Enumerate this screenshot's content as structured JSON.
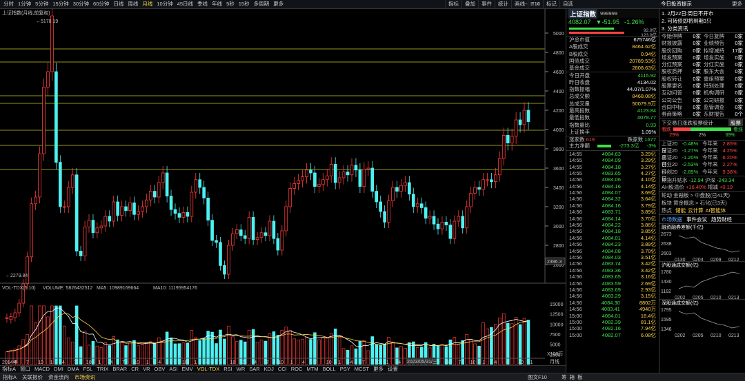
{
  "toolbar": {
    "periods": [
      "分时",
      "1分钟",
      "5分钟",
      "15分钟",
      "30分钟",
      "60分钟",
      "日线",
      "周线",
      "月线",
      "10分钟",
      "45日线",
      "季线",
      "年线",
      "5秒",
      "15秒",
      "多周期",
      "更多"
    ],
    "active_period": "月线",
    "tools": [
      "指标",
      "叠加",
      "事件",
      "统计",
      "画线",
      "F10",
      "标记",
      "自选"
    ],
    "window_controls": [
      "–",
      "□",
      "×"
    ],
    "right_title": "今日投资提示",
    "right_more": "更多"
  },
  "chart": {
    "title": "上证指数(月线,前复权)",
    "high_label": "5178.19",
    "low_label": "2279.84",
    "last_box": "2396.3",
    "y_ticks": [
      "5000",
      "4800",
      "4600",
      "4400",
      "4200",
      "4000",
      "3800",
      "3600",
      "3400",
      "3200",
      "3000",
      "2800",
      "2600"
    ],
    "x_ticks": [
      "2014年",
      "4",
      "7",
      "10",
      "1",
      "4",
      "7",
      "10",
      "1",
      "4",
      "7",
      "10",
      "1",
      "4",
      "7",
      "10",
      "1",
      "4",
      "7",
      "10",
      "1",
      "4",
      "7",
      "10",
      "1",
      "4",
      "7",
      "10",
      "1",
      "4",
      "7",
      "10",
      "1",
      "4",
      "7",
      "10",
      "1",
      "4",
      "7",
      "10",
      "1",
      "4",
      "7",
      "10",
      "1"
    ],
    "cursor_date": "2023/05/31/三",
    "corner_label": "月线",
    "zoom_label": "X100万",
    "colors": {
      "up": "#ff3b3b",
      "down": "#4ef0f0",
      "ma_line": "#ffd24a"
    }
  },
  "volume": {
    "header": "VOL-TDX(5,10)",
    "volume_label": "VOLUME: 5826432512",
    "ma5_label": "MA5: 10989169664",
    "ma10_label": "MA10: 11195954176",
    "y_ticks": [
      "15000",
      "12500",
      "10000",
      "7500",
      "5000",
      "2500"
    ]
  },
  "indicators": [
    "指标A",
    "窗口",
    "MACD",
    "DMI",
    "DMA",
    "FSL",
    "TRIX",
    "BRAR",
    "CR",
    "VR",
    "OBV",
    "ASI",
    "EMV",
    "VOL-TDX",
    "RSI",
    "WR",
    "SAR",
    "KDJ",
    "CCI",
    "ROC",
    "MTM",
    "BOLL",
    "PSY",
    "MCST",
    "更多",
    "设置"
  ],
  "active_indicator": "VOL-TDX",
  "quote": {
    "index_name": "上证指数",
    "code": "999999",
    "price": "4082.07",
    "change": "▼-51.95",
    "change_pct": "-1.26%",
    "bar1_label": "92.0亿",
    "bar2_label": "123.0亿",
    "rows": [
      {
        "k": "沪总市值",
        "v": "675746亿",
        "c": "white"
      },
      {
        "k": "A股成交",
        "v": "8464.62亿",
        "c": "yellow"
      },
      {
        "k": "B股成交",
        "v": "0.94亿",
        "c": "yellow"
      },
      {
        "k": "国债成交",
        "v": "20789.53亿",
        "c": "yellow"
      },
      {
        "k": "基金成交",
        "v": "2808.63亿",
        "c": "yellow"
      },
      {
        "k": "今日开盘",
        "v": "4115.92",
        "c": "green"
      },
      {
        "k": "昨日收盘",
        "v": "4134.02",
        "c": "white"
      },
      {
        "k": "指数振幅",
        "v": "44.07/1.07%",
        "c": "white"
      },
      {
        "k": "总成交额",
        "v": "8468.08亿",
        "c": "yellow"
      },
      {
        "k": "总成交量",
        "v": "50079.9万",
        "c": "yellow"
      },
      {
        "k": "最高指数",
        "v": "4123.84",
        "c": "green"
      },
      {
        "k": "最低指数",
        "v": "4079.77",
        "c": "green"
      },
      {
        "k": "指数量比",
        "v": "0.93",
        "c": "green"
      },
      {
        "k": "上证换手",
        "v": "1.05%",
        "c": "white"
      }
    ],
    "up_label": "涨家数",
    "up_count": "619",
    "down_label": "跌家数",
    "down_count": "1677",
    "main_flow_label": "主力净额",
    "main_flow_value": "-273.3亿",
    "main_flow_pct": "-3%",
    "ticks": [
      {
        "t": "14:55",
        "p": "4084.63",
        "v": "3.29亿"
      },
      {
        "t": "14:55",
        "p": "4084.09",
        "v": "3.29亿"
      },
      {
        "t": "14:55",
        "p": "4084.18",
        "v": "3.27亿"
      },
      {
        "t": "14:55",
        "p": "4083.65",
        "v": "4.27亿"
      },
      {
        "t": "14:56",
        "p": "4084.06",
        "v": "4.10亿"
      },
      {
        "t": "14:56",
        "p": "4084.16",
        "v": "4.14亿"
      },
      {
        "t": "14:56",
        "p": "4084.07",
        "v": "3.69亿"
      },
      {
        "t": "14:56",
        "p": "4084.32",
        "v": "3.64亿"
      },
      {
        "t": "14:56",
        "p": "4084.16",
        "v": "3.79亿"
      },
      {
        "t": "14:56",
        "p": "4083.71",
        "v": "3.89亿"
      },
      {
        "t": "14:56",
        "p": "4084.14",
        "v": "3.70亿"
      },
      {
        "t": "14:56",
        "p": "4084.22",
        "v": "3.86亿"
      },
      {
        "t": "14:56",
        "p": "4084.18",
        "v": "3.85亿"
      },
      {
        "t": "14:56",
        "p": "4084.01",
        "v": "4.14亿"
      },
      {
        "t": "14:56",
        "p": "4084.23",
        "v": "3.89亿"
      },
      {
        "t": "14:56",
        "p": "4084.08",
        "v": "3.70亿"
      },
      {
        "t": "14:56",
        "p": "4084.03",
        "v": "3.51亿"
      },
      {
        "t": "14:56",
        "p": "4083.74",
        "v": "3.42亿"
      },
      {
        "t": "14:56",
        "p": "4083.36",
        "v": "3.42亿"
      },
      {
        "t": "14:56",
        "p": "4083.65",
        "v": "3.16亿"
      },
      {
        "t": "14:56",
        "p": "4083.59",
        "v": "2.69亿"
      },
      {
        "t": "14:56",
        "p": "4083.69",
        "v": "2.93亿"
      },
      {
        "t": "14:56",
        "p": "4083.29",
        "v": "3.15亿"
      },
      {
        "t": "14:56",
        "p": "4084.30",
        "v": "8802万"
      },
      {
        "t": "14:56",
        "p": "4083.41",
        "v": "4940万"
      },
      {
        "t": "15:00",
        "p": "4084.01",
        "v": "18.4亿"
      },
      {
        "t": "15:00",
        "p": "4082.39",
        "v": "81.1亿"
      },
      {
        "t": "15:00",
        "p": "4082.16",
        "v": "7.94亿"
      },
      {
        "t": "15:00",
        "p": "4082.07",
        "v": "6.08亿"
      }
    ]
  },
  "info": {
    "tips": [
      "1. 2月22日:周日不开市",
      "2. 可转债即将到期3只",
      "3. 分类资讯"
    ],
    "stats": [
      [
        "今始停牌",
        "0家",
        "今日复牌",
        "0家"
      ],
      [
        "财报披露",
        "0家",
        "业绩预告",
        "0家"
      ],
      [
        "股份回购",
        "0家",
        "拟增减持",
        "17家"
      ],
      [
        "增发预案",
        "0家",
        "增发实施",
        "0家"
      ],
      [
        "分红预案",
        "0家",
        "分红实施",
        "0家"
      ],
      [
        "股权质押",
        "0家",
        "股东大会",
        "0家"
      ],
      [
        "股权转让",
        "0家",
        "重组预案",
        "0家"
      ],
      [
        "股票更名",
        "0家",
        "特别处理",
        "0家"
      ],
      [
        "互动问答",
        "0家",
        "机构调研",
        "0家"
      ],
      [
        "公司公告",
        "0家",
        "公司研报",
        "0家"
      ],
      [
        "合同中标",
        "0家",
        "监管调查",
        "0家"
      ],
      [
        "券商策略",
        "0家",
        "东财报告",
        "0个"
      ]
    ],
    "limit_title": "下交易日涨跌股票统计",
    "limit_button": "股票",
    "rise_label": "看跌",
    "fall_label": "看涨",
    "rise_pct": "29%",
    "flat_pct": "2%",
    "fall_pct": "69%",
    "perf": [
      [
        "上证20日",
        "-0.48%",
        "今年来",
        "2.85%"
      ],
      [
        "深证20日",
        "-1.27%",
        "今年来",
        "4.25%"
      ],
      [
        "北证20日",
        "-1.20%",
        "今年来",
        "6.20%"
      ],
      [
        "创业20日",
        "-2.53%",
        "今年来",
        "2.27%"
      ],
      [
        "科创20日",
        "-2.89%",
        "今年来",
        "9.38%"
      ]
    ],
    "futures_label": "期指升贴水",
    "futures_v1": "-12.94",
    "futures_label2": "沪深",
    "futures_v2": "-243.34",
    "ah_label": "AH股溢价",
    "ah_v1": "+16.40%",
    "ah_label2": "增减",
    "ah_v2": "+0.19",
    "rotation": [
      "轮动 金融板 > 中盘股(已41天)",
      "板块 黄金概念 > 石化(已3天)"
    ],
    "hot_label": "热点",
    "hot_items": [
      "储能",
      "云计算",
      "AI智能体"
    ],
    "news_tabs": [
      "市场数据",
      "事件会议",
      "趋势财经"
    ],
    "mini_charts": [
      {
        "title": "融资融券差额(千亿)",
        "ticks": [
          "2673",
          "2638",
          "2603"
        ],
        "dates": [
          "0130",
          "0204",
          "0209",
          "0212"
        ]
      },
      {
        "title": "沪股通成交额(亿)",
        "ticks": [
          "1780",
          "1430",
          "1182"
        ],
        "dates": [
          "0202",
          "0205",
          "0210",
          "0213"
        ]
      },
      {
        "title": "深股通成交额(亿)",
        "ticks": [
          "1795",
          "1595",
          "1346"
        ],
        "dates": [
          "0202",
          "0205",
          "0210",
          "0213"
        ]
      }
    ]
  },
  "status_bar": [
    "指标A",
    "关联报价",
    "资金流向",
    "市场资讯"
  ],
  "status_active": "市场资讯",
  "status_right": "图文F10",
  "side_labels": [
    "筹",
    "箱",
    "板"
  ]
}
